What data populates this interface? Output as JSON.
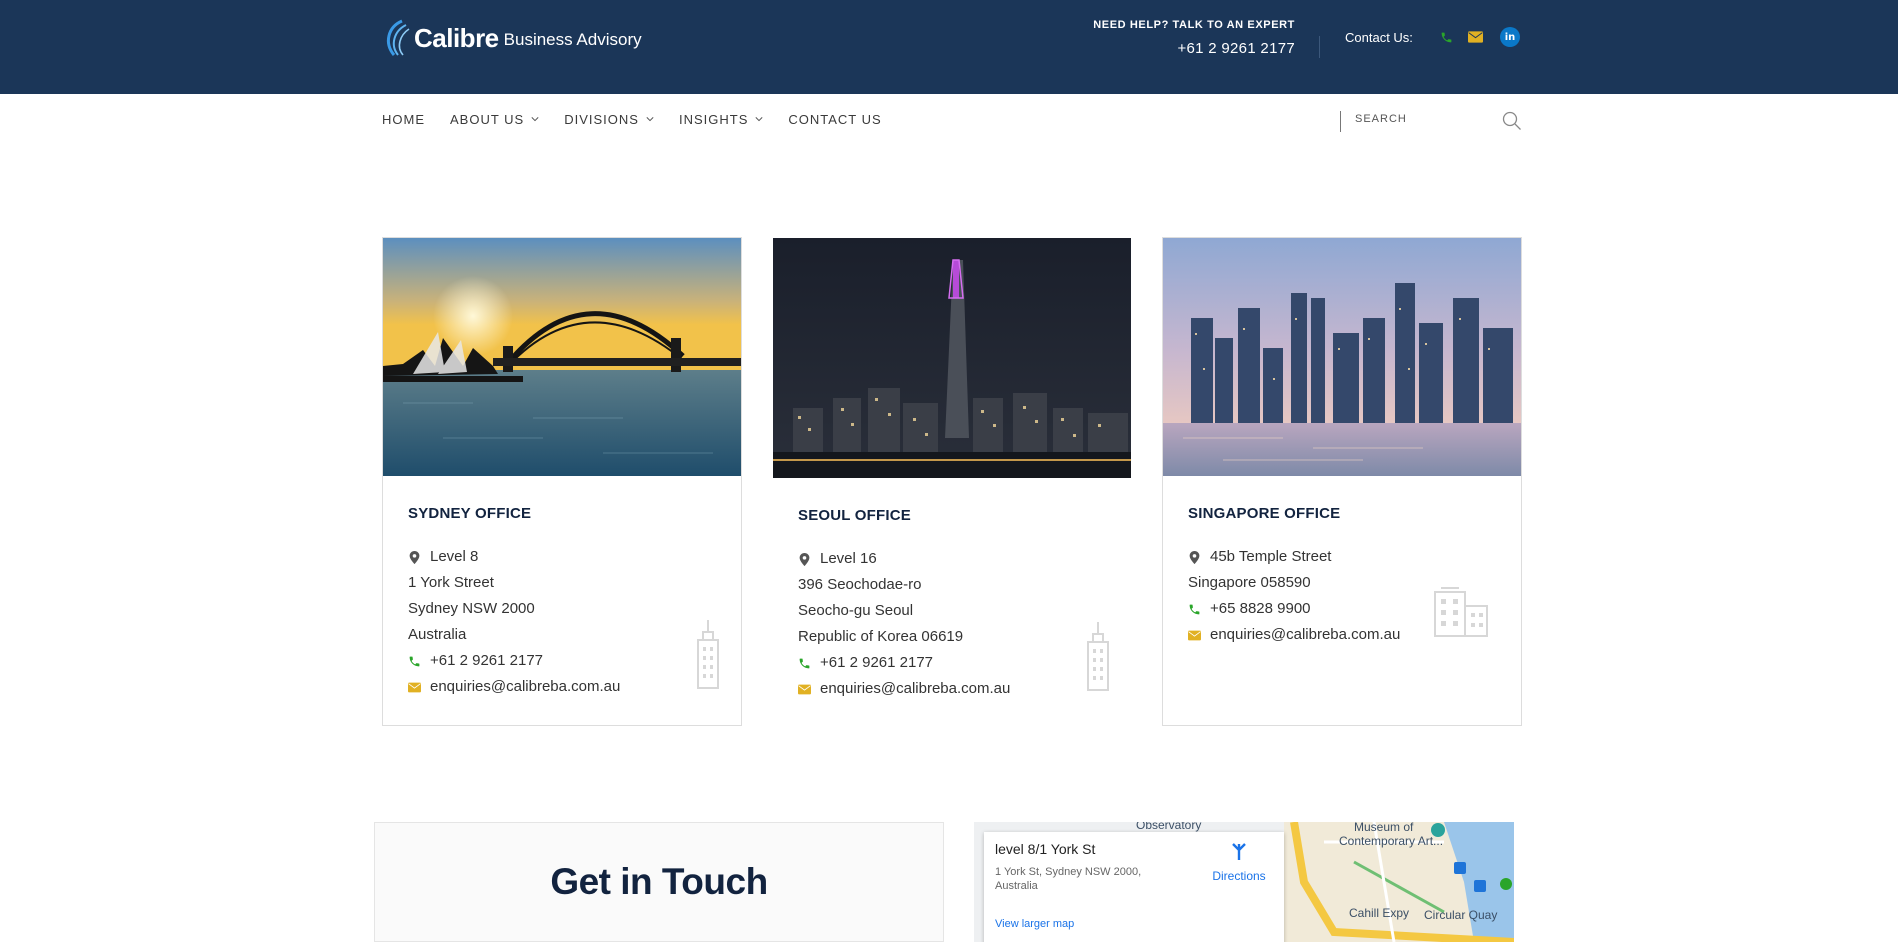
{
  "header": {
    "logo_main": "Calibre",
    "logo_sub": "Business Advisory",
    "help_label": "NEED HELP? TALK TO AN EXPERT",
    "help_phone": "+61 2 9261 2177",
    "contact_label": "Contact Us:",
    "icons": [
      "phone-icon",
      "email-icon",
      "linkedin-icon"
    ],
    "linkedin_text": "in"
  },
  "nav": {
    "items": [
      {
        "label": "HOME",
        "dropdown": false
      },
      {
        "label": "ABOUT US",
        "dropdown": true
      },
      {
        "label": "DIVISIONS",
        "dropdown": true
      },
      {
        "label": "INSIGHTS",
        "dropdown": true
      },
      {
        "label": "CONTACT US",
        "dropdown": false
      }
    ],
    "search_placeholder": "SEARCH"
  },
  "offices": [
    {
      "title": "SYDNEY OFFICE",
      "address": [
        "Level 8",
        "1 York Street",
        "Sydney NSW 2000",
        "Australia"
      ],
      "phone": "+61 2 9261 2177",
      "email": "enquiries@calibreba.com.au"
    },
    {
      "title": "SEOUL OFFICE",
      "address": [
        "Level 16",
        "396 Seochodae-ro",
        "Seocho-gu Seoul",
        "Republic of Korea 06619"
      ],
      "phone": "+61 2 9261 2177",
      "email": "enquiries@calibreba.com.au"
    },
    {
      "title": "SINGAPORE OFFICE",
      "address": [
        "45b Temple Street",
        "Singapore 058590"
      ],
      "phone": "+65 8828 9900",
      "email": "enquiries@calibreba.com.au"
    }
  ],
  "contact": {
    "title": "Get in Touch"
  },
  "map": {
    "place_name": "level 8/1 York St",
    "place_address": "1 York St, Sydney NSW 2000, Australia",
    "directions_label": "Directions",
    "larger_map_label": "View larger map",
    "poi_1": "Observatory",
    "poi_2": "Museum of",
    "poi_3": "Contemporary Art...",
    "road_1": "Cahill Expy",
    "road_2": "Circular Quay"
  },
  "colors": {
    "header_bg": "#1b3658",
    "title_navy": "#12233f",
    "phone_green": "#2aa52a",
    "email_gold": "#e1b123",
    "linkedin_blue": "#0a78c8"
  }
}
